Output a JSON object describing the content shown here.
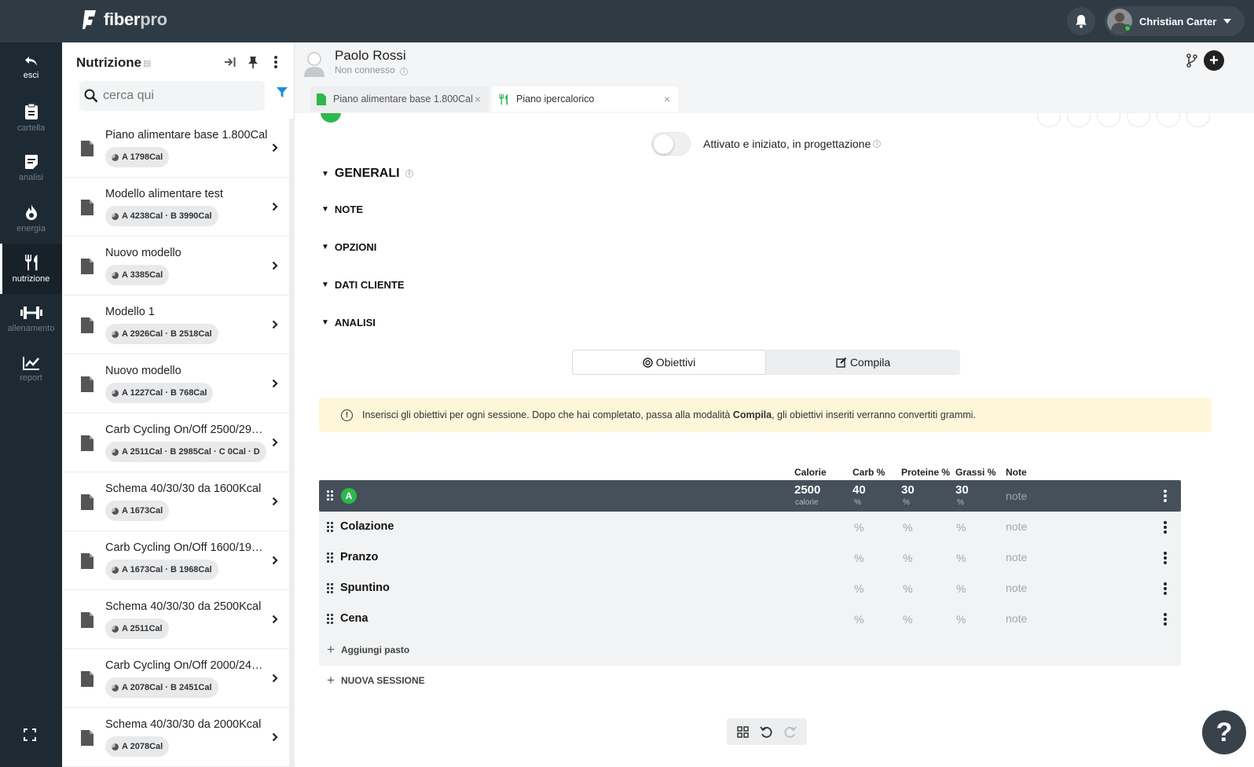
{
  "app": {
    "logo_prefix": "fiber",
    "logo_suffix": "pro",
    "user_name": "Christian Carter"
  },
  "nav": [
    {
      "label": "esci",
      "icon": "undo-arrow-icon"
    },
    {
      "label": "cartella",
      "icon": "clipboard-icon"
    },
    {
      "label": "analisi",
      "icon": "document-icon"
    },
    {
      "label": "energia",
      "icon": "flame-icon"
    },
    {
      "label": "nutrizione",
      "icon": "utensils-icon"
    },
    {
      "label": "allenamento",
      "icon": "dumbbell-icon"
    },
    {
      "label": "report",
      "icon": "chart-line-icon"
    }
  ],
  "list_panel": {
    "title": "Nutrizione",
    "search_placeholder": "cerca qui",
    "items": [
      {
        "title": "Piano alimentare base 1.800Cal",
        "badge": "A 1798Cal"
      },
      {
        "title": "Modello alimentare test",
        "badge": "A 4238Cal · B 3990Cal"
      },
      {
        "title": "Nuovo modello",
        "badge": "A 3385Cal"
      },
      {
        "title": "Modello 1",
        "badge": "A 2926Cal · B 2518Cal"
      },
      {
        "title": "Nuovo modello",
        "badge": "A 1227Cal · B 768Cal"
      },
      {
        "title": "Carb Cycling On/Off 2500/290…",
        "badge": "A 2511Cal · B 2985Cal · C 0Cal · D"
      },
      {
        "title": "Schema 40/30/30 da 1600Kcal",
        "badge": "A 1673Cal"
      },
      {
        "title": "Carb Cycling On/Off 1600/190…",
        "badge": "A 1673Cal · B 1968Cal"
      },
      {
        "title": "Schema 40/30/30 da 2500Kcal",
        "badge": "A 2511Cal"
      },
      {
        "title": "Carb Cycling On/Off 2000/240…",
        "badge": "A 2078Cal · B 2451Cal"
      },
      {
        "title": "Schema 40/30/30 da 2000Kcal",
        "badge": "A 2078Cal"
      }
    ]
  },
  "client": {
    "name": "Paolo Rossi",
    "status": "Non connesso"
  },
  "tabs": [
    {
      "label": "Piano alimentare base 1.800Cal",
      "active": false
    },
    {
      "label": "Piano ipercalorico",
      "active": true
    }
  ],
  "plan": {
    "toggle_label": "Attivato e iniziato, in progettazione",
    "toggle_on": false,
    "sections": [
      "GENERALI",
      "NOTE",
      "OPZIONI",
      "DATI CLIENTE",
      "ANALISI"
    ],
    "segments": {
      "objectives": "Obiettivi",
      "fill": "Compila",
      "active": "objectives"
    },
    "alert": {
      "before": "Inserisci gli obiettivi per ogni sessione. Dopo che hai completato, passa alla modalità ",
      "bold": "Compila",
      "after": ", gli obiettivi inseriti verranno convertiti grammi."
    },
    "columns": {
      "calories": "Calorie",
      "carb": "Carb %",
      "protein": "Proteine %",
      "fat": "Grassi %",
      "notes": "Note"
    },
    "session": {
      "letter": "A",
      "calories": "2500",
      "calories_unit": "calorie",
      "carb": "40",
      "protein": "30",
      "fat": "30",
      "pct": "%",
      "note_placeholder": "note"
    },
    "meals": [
      {
        "name": "Colazione"
      },
      {
        "name": "Pranzo"
      },
      {
        "name": "Spuntino"
      },
      {
        "name": "Cena"
      }
    ],
    "meal_pct": "%",
    "meal_note": "note",
    "add_meal": "Aggiungi pasto",
    "new_session": "NUOVA SESSIONE"
  },
  "help_label": "?"
}
